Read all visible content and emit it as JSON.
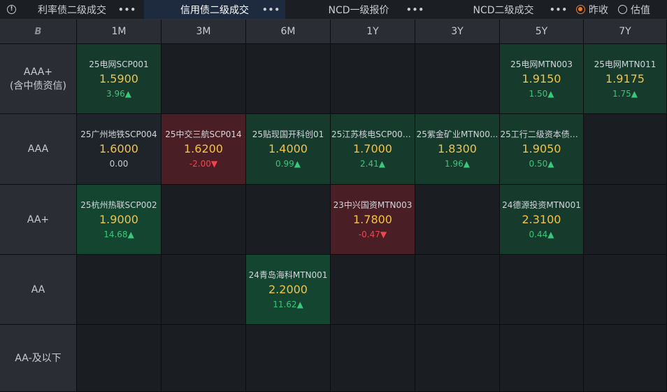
{
  "tabs": [
    {
      "label": "利率债二级成交",
      "active": false
    },
    {
      "label": "信用债二级成交",
      "active": true
    },
    {
      "label": "NCD一级报价",
      "active": false
    },
    {
      "label": "NCD二级成交",
      "active": false
    }
  ],
  "more_glyph": "•••",
  "radio": {
    "options": [
      {
        "label": "昨收",
        "selected": true
      },
      {
        "label": "估值",
        "selected": false
      }
    ]
  },
  "grid": {
    "corner_icon": "B",
    "columns": [
      "1M",
      "3M",
      "6M",
      "1Y",
      "3Y",
      "5Y",
      "7Y"
    ],
    "rows": [
      {
        "label": [
          "AAA+",
          "(含中债资信)"
        ]
      },
      {
        "label": [
          "AAA"
        ]
      },
      {
        "label": [
          "AA+"
        ]
      },
      {
        "label": [
          "AA"
        ]
      },
      {
        "label": [
          "AA-及以下"
        ]
      }
    ],
    "cells": [
      [
        {
          "name": "25电网SCP001",
          "yield": "1.5900",
          "chg": "3.96",
          "dir": "up"
        },
        null,
        null,
        null,
        null,
        {
          "name": "25电网MTN003",
          "yield": "1.9150",
          "chg": "1.50",
          "dir": "up"
        },
        {
          "name": "25电网MTN011",
          "yield": "1.9175",
          "chg": "1.75",
          "dir": "up"
        }
      ],
      [
        {
          "name": "25广州地铁SCP004",
          "yield": "1.6000",
          "chg": "0.00",
          "dir": "flat"
        },
        {
          "name": "25中交三航SCP014",
          "yield": "1.6200",
          "chg": "-2.00",
          "dir": "down"
        },
        {
          "name": "25贴现国开科创01",
          "yield": "1.4000",
          "chg": "0.99",
          "dir": "up"
        },
        {
          "name": "25江苏核电SCP001...",
          "yield": "1.7000",
          "chg": "2.41",
          "dir": "up"
        },
        {
          "name": "25紫金矿业MTN00...",
          "yield": "1.8300",
          "chg": "1.96",
          "dir": "up"
        },
        {
          "name": "25工行二级资本债0...",
          "yield": "1.9050",
          "chg": "0.50",
          "dir": "up"
        },
        null
      ],
      [
        {
          "name": "25杭州热联SCP002",
          "yield": "1.9000",
          "chg": "14.68",
          "dir": "up-strong"
        },
        null,
        null,
        {
          "name": "23中兴国资MTN003",
          "yield": "1.7800",
          "chg": "-0.47",
          "dir": "down"
        },
        null,
        {
          "name": "24德源投资MTN001",
          "yield": "2.3100",
          "chg": "0.44",
          "dir": "up"
        },
        null
      ],
      [
        null,
        null,
        {
          "name": "24青岛海科MTN001",
          "yield": "2.2000",
          "chg": "11.62",
          "dir": "up-strong"
        },
        null,
        null,
        null,
        null
      ],
      [
        null,
        null,
        null,
        null,
        null,
        null,
        null
      ]
    ]
  },
  "colors": {
    "up": "#3ac77a",
    "down": "#f0454f",
    "yield": "#f2c34b",
    "accent": "#f07b2a"
  },
  "arrows": {
    "up": "▲",
    "down": "▼"
  }
}
